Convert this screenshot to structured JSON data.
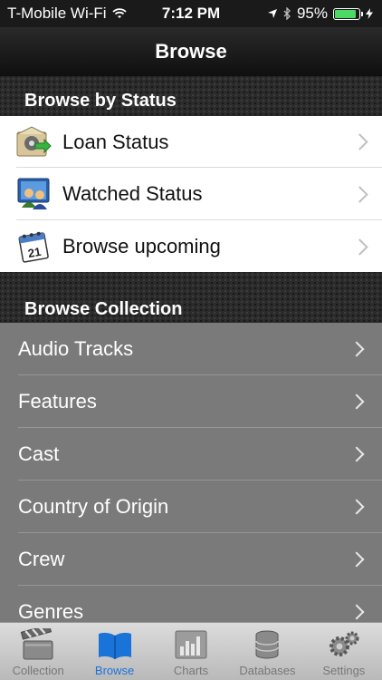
{
  "status_bar": {
    "carrier": "T-Mobile Wi-Fi",
    "time": "7:12 PM",
    "battery_percent": "95%",
    "battery_level": 0.95
  },
  "nav": {
    "title": "Browse"
  },
  "sections": {
    "status": {
      "title": "Browse by Status",
      "items": [
        {
          "label": "Loan Status",
          "icon": "loan-envelope-icon"
        },
        {
          "label": "Watched Status",
          "icon": "people-monitor-icon"
        },
        {
          "label": "Browse upcoming",
          "icon": "calendar-icon",
          "calendar_day": "21"
        }
      ]
    },
    "collection": {
      "title": "Browse Collection",
      "items": [
        {
          "label": "Audio Tracks"
        },
        {
          "label": "Features"
        },
        {
          "label": "Cast"
        },
        {
          "label": "Country of Origin"
        },
        {
          "label": "Crew"
        },
        {
          "label": "Genres"
        }
      ]
    }
  },
  "tabs": [
    {
      "label": "Collection",
      "icon": "clapperboard-icon",
      "active": false
    },
    {
      "label": "Browse",
      "icon": "book-icon",
      "active": true
    },
    {
      "label": "Charts",
      "icon": "bar-chart-icon",
      "active": false
    },
    {
      "label": "Databases",
      "icon": "database-icon",
      "active": false
    },
    {
      "label": "Settings",
      "icon": "gears-icon",
      "active": false
    }
  ],
  "colors": {
    "active_tab": "#1a73d9",
    "inactive_tab": "#777777",
    "battery": "#4cd964",
    "collection_bg": "#7a7a7a"
  }
}
